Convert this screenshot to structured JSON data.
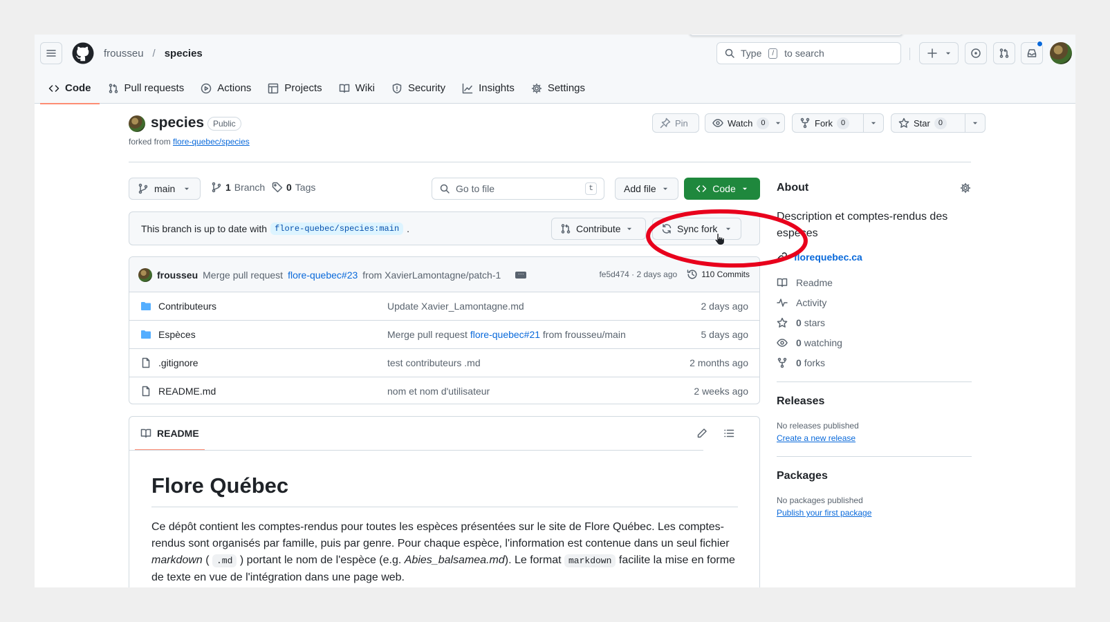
{
  "header": {
    "owner": "frousseu",
    "separator": "/",
    "repo": "species",
    "search_prefix": "Type",
    "search_key": "/",
    "search_suffix": "to search"
  },
  "nav": {
    "tabs": [
      {
        "label": "Code",
        "icon": "code-icon",
        "active": true
      },
      {
        "label": "Pull requests",
        "icon": "git-pull-request-icon"
      },
      {
        "label": "Actions",
        "icon": "play-icon"
      },
      {
        "label": "Projects",
        "icon": "table-icon"
      },
      {
        "label": "Wiki",
        "icon": "book-icon"
      },
      {
        "label": "Security",
        "icon": "shield-icon"
      },
      {
        "label": "Insights",
        "icon": "graph-icon"
      },
      {
        "label": "Settings",
        "icon": "gear-icon"
      }
    ]
  },
  "repo": {
    "name": "species",
    "visibility": "Public",
    "forked_prefix": "forked from",
    "forked_from": "flore-quebec/species",
    "pin_label": "Pin",
    "watch_label": "Watch",
    "watch_count": "0",
    "fork_label": "Fork",
    "fork_count": "0",
    "star_label": "Star",
    "star_count": "0"
  },
  "toolbar": {
    "branch": "main",
    "branch_count": "1",
    "branch_label": "Branch",
    "tag_count": "0",
    "tag_label": "Tags",
    "goto_placeholder": "Go to file",
    "goto_key": "t",
    "add_file_label": "Add file",
    "code_label": "Code"
  },
  "sync": {
    "text": "This branch is up to date with",
    "ref": "flore-quebec/species:main",
    "period": ".",
    "contribute_label": "Contribute",
    "sync_label": "Sync fork"
  },
  "commit": {
    "author": "frousseu",
    "message_prefix": "Merge pull request",
    "pr_link": "flore-quebec#23",
    "message_suffix": "from XavierLamontagne/patch-1",
    "hash_time": "fe5d474 · 2 days ago",
    "commits_label": "110 Commits"
  },
  "files": [
    {
      "name": "Contributeurs",
      "type": "folder",
      "msg": "Update Xavier_Lamontagne.md",
      "msg_link": "",
      "msg_suffix": "",
      "date": "2 days ago"
    },
    {
      "name": "Espèces",
      "type": "folder",
      "msg": "Merge pull request",
      "msg_link": "flore-quebec#21",
      "msg_suffix": "from frousseu/main",
      "date": "5 days ago"
    },
    {
      "name": ".gitignore",
      "type": "file",
      "msg": "test contributeurs .md",
      "msg_link": "",
      "msg_suffix": "",
      "date": "2 months ago"
    },
    {
      "name": "README.md",
      "type": "file",
      "msg": "nom et nom d'utilisateur",
      "msg_link": "",
      "msg_suffix": "",
      "date": "2 weeks ago"
    }
  ],
  "readme": {
    "tab_label": "README",
    "heading": "Flore Québec",
    "p1": "Ce dépôt contient les comptes-rendus pour toutes les espèces présentées sur le site de Flore Québec. Les comptes-rendus sont organisés par famille, puis par genre. Pour chaque espèce, l'information est contenue dans un seul fichier",
    "p_markdown_italic": "markdown",
    "p_paren_open": "(",
    "p_code_md": ".md",
    "p_paren_close": ") portant le nom de l'espèce (e.g.",
    "p_example": "Abies_balsamea.md",
    "p_after_example": "). Le format",
    "p_code_markdown": "markdown",
    "p_end": "facilite la mise en forme de texte en vue de l'intégration dans une page web."
  },
  "sidebar": {
    "about_title": "About",
    "description": "Description et comptes-rendus des espèces",
    "website": "florequebec.ca",
    "readme_label": "Readme",
    "activity_label": "Activity",
    "stars_count": "0",
    "stars_label": "stars",
    "watching_count": "0",
    "watching_label": "watching",
    "forks_count": "0",
    "forks_label": "forks",
    "releases_title": "Releases",
    "releases_none": "No releases published",
    "releases_link": "Create a new release",
    "packages_title": "Packages",
    "packages_none": "No packages published",
    "packages_link": "Publish your first package"
  },
  "colors": {
    "code_button": "#1f883d",
    "link": "#0969da",
    "active_tab_underline": "#fd8c73",
    "annotation_ring": "#e8001c"
  }
}
